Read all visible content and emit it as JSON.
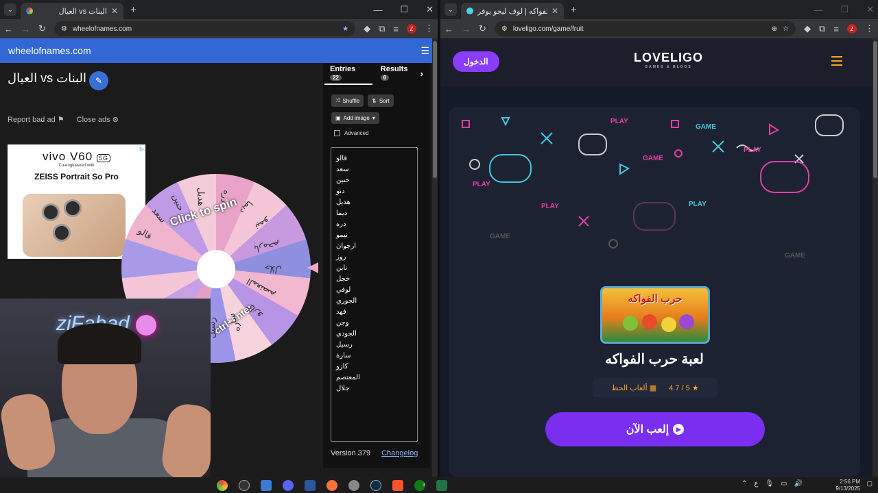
{
  "left_window": {
    "tab_title": "العيال vs البنات",
    "url": "wheelofnames.com",
    "site_header": "wheelofnames.com",
    "wheel_title": "العيال vs البنات",
    "report_ad": "Report bad ad",
    "close_ads": "Close ads",
    "ad": {
      "brand": "vivo V60",
      "badge": "5G",
      "sub": "Co-engineered with",
      "tagline": "ZEISS Portrait So Pro"
    },
    "wheel_spin_text": "Click to spin",
    "wheel_ctrl_text": "ctrl+enter",
    "wheel_labels": [
      "قالو",
      "سعد",
      "حنين",
      "هديل",
      "دره",
      "ديما",
      "نيمو",
      "بارمحم",
      "جلال",
      "المعتصم",
      "كازو",
      "ساره",
      "رسيل",
      "الجوري",
      "وجن"
    ],
    "panel": {
      "entries_tab": "Entries",
      "entries_count": "22",
      "results_tab": "Results",
      "results_count": "0",
      "shuffle": "Shuffle",
      "sort": "Sort",
      "add_image": "Add image",
      "advanced": "Advanced",
      "entries": [
        "قالو",
        "سعد",
        "حنين",
        "دنو",
        "هديل",
        "ديما",
        "دره",
        "نيمو",
        "ارجوان",
        "روز",
        "نابن",
        "خجل",
        "لوفي",
        "الجوري",
        "فهد",
        "وجن",
        "الجودي",
        "رسيل",
        "سارة",
        "كازو",
        "المعتصم",
        "جلال"
      ],
      "version": "Version 379",
      "changelog": "Changelog"
    },
    "webcam_sign": "ziFahad"
  },
  "right_window": {
    "tab_title": "لعبة حرب الفواكه | لوف ليجو يوفر",
    "url": "loveligo.com/game/fruit",
    "login": "الدخول",
    "logo": "LOVELIGO",
    "logo_sub": "GAMES & BLOGS",
    "game_image_text": "حرب الفواكه",
    "game_title": "لعبة حرب الفواكه",
    "rating": "4.7 / 5",
    "category": "ألعاب الحظ",
    "play_button": "إلعب الآن"
  },
  "taskbar": {
    "time": "2:56 PM",
    "date": "9/13/2025",
    "lang": "ع",
    "xbox_badge": "3"
  },
  "colors": {
    "wheel_header": "#3367d6",
    "play_purple": "#7a2ff0",
    "login_purple": "#8b3dff",
    "accent_orange": "#f5a623"
  }
}
